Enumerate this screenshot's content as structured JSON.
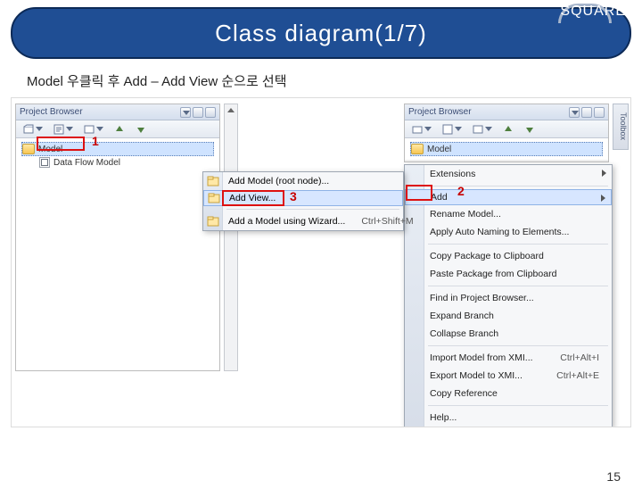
{
  "header": {
    "title": "Class diagram(1/7)",
    "brand": "SQUARE"
  },
  "subtitle": "Model 우클릭 후 Add – Add View 순으로 선택",
  "colors": {
    "header_bg": "#1f4e94",
    "callout": "#d11"
  },
  "left_browser": {
    "title": "Project Browser",
    "tree": [
      {
        "label": "Model",
        "selected": true
      },
      {
        "label": "Data Flow Model",
        "selected": false
      }
    ]
  },
  "right_browser": {
    "title": "Project Browser",
    "tree": [
      {
        "label": "Model",
        "selected": true
      }
    ]
  },
  "toolbox_tab": "Toolbox",
  "context_menu": {
    "items": [
      {
        "label": "Extensions",
        "submenu": true
      },
      {
        "sep": true
      },
      {
        "label": "Add",
        "submenu": true,
        "highlight": true
      },
      {
        "label": "Rename Model...",
        "submenu": false
      },
      {
        "label": "Apply Auto Naming to Elements...",
        "submenu": false
      },
      {
        "sep": true
      },
      {
        "label": "Copy Package to Clipboard"
      },
      {
        "label": "Paste Package from Clipboard"
      },
      {
        "sep": true
      },
      {
        "label": "Find in Project Browser..."
      },
      {
        "label": "Expand Branch"
      },
      {
        "label": "Collapse Branch"
      },
      {
        "sep": true
      },
      {
        "label": "Import Model from XMI...",
        "shortcut": "Ctrl+Alt+I"
      },
      {
        "label": "Export Model to XMI...",
        "shortcut": "Ctrl+Alt+E"
      },
      {
        "label": "Copy Reference"
      },
      {
        "sep": true
      },
      {
        "label": "Help..."
      }
    ]
  },
  "add_submenu": {
    "items": [
      {
        "label": "Add Model (root node)..."
      },
      {
        "label": "Add View...",
        "highlight": true
      },
      {
        "label": "Add a Model using Wizard...",
        "shortcut": "Ctrl+Shift+M"
      }
    ]
  },
  "callouts": {
    "one": "1",
    "two": "2",
    "three": "3"
  },
  "page_number": "15"
}
